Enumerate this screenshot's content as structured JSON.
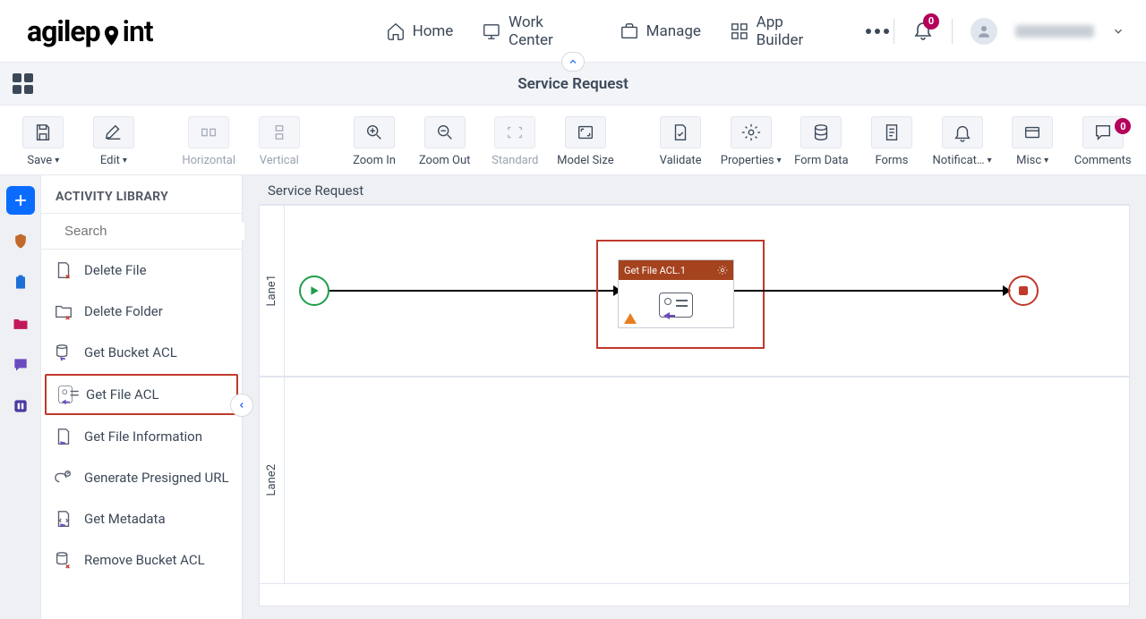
{
  "header": {
    "logo_text_a": "agilep",
    "logo_text_b": "int",
    "nav": {
      "home": "Home",
      "work_center": "Work Center",
      "manage": "Manage",
      "app_builder": "App Builder"
    },
    "notif_badge": "0"
  },
  "subheader": {
    "title": "Service Request"
  },
  "toolbar": {
    "save": "Save",
    "edit": "Edit",
    "horizontal": "Horizontal",
    "vertical": "Vertical",
    "zoom_in": "Zoom In",
    "zoom_out": "Zoom Out",
    "standard": "Standard",
    "model_size": "Model Size",
    "validate": "Validate",
    "properties": "Properties",
    "form_data": "Form Data",
    "forms": "Forms",
    "notifications": "Notificat…",
    "misc": "Misc",
    "comments": "Comments",
    "comments_badge": "0"
  },
  "library": {
    "title": "ACTIVITY LIBRARY",
    "search_placeholder": "Search",
    "items": [
      {
        "label": "Delete File"
      },
      {
        "label": "Delete Folder"
      },
      {
        "label": "Get Bucket ACL"
      },
      {
        "label": "Get File ACL",
        "highlight": true
      },
      {
        "label": "Get File Information"
      },
      {
        "label": "Generate Presigned URL"
      },
      {
        "label": "Get Metadata"
      },
      {
        "label": "Remove Bucket ACL"
      }
    ]
  },
  "canvas": {
    "title": "Service Request",
    "lane1": "Lane1",
    "lane2": "Lane2",
    "activity_title": "Get File ACL.1"
  }
}
